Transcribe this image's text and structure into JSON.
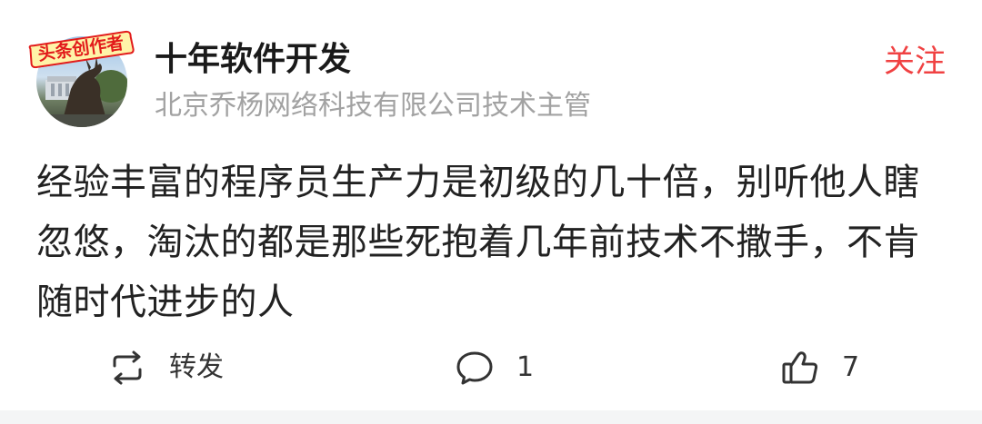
{
  "author": {
    "name": "十年软件开发",
    "title": "北京乔杨网络科技有限公司技术主管",
    "avatar_badge": "头条创作者"
  },
  "follow_label": "关注",
  "post": {
    "text": "经验丰富的程序员生产力是初级的几十倍，别听他人瞎忽悠，淘汰的都是那些死抱着几年前技术不撒手，不肯随时代进步的人"
  },
  "actions": {
    "repost": {
      "label": "转发",
      "icon": "repost-icon"
    },
    "comment": {
      "count": "1",
      "icon": "comment-icon"
    },
    "like": {
      "count": "7",
      "icon": "thumbs-up-icon"
    }
  },
  "colors": {
    "accent": "#f04142",
    "secondary_text": "#a2a2a2",
    "body_text": "#222222",
    "badge_red": "#e21b1b"
  }
}
